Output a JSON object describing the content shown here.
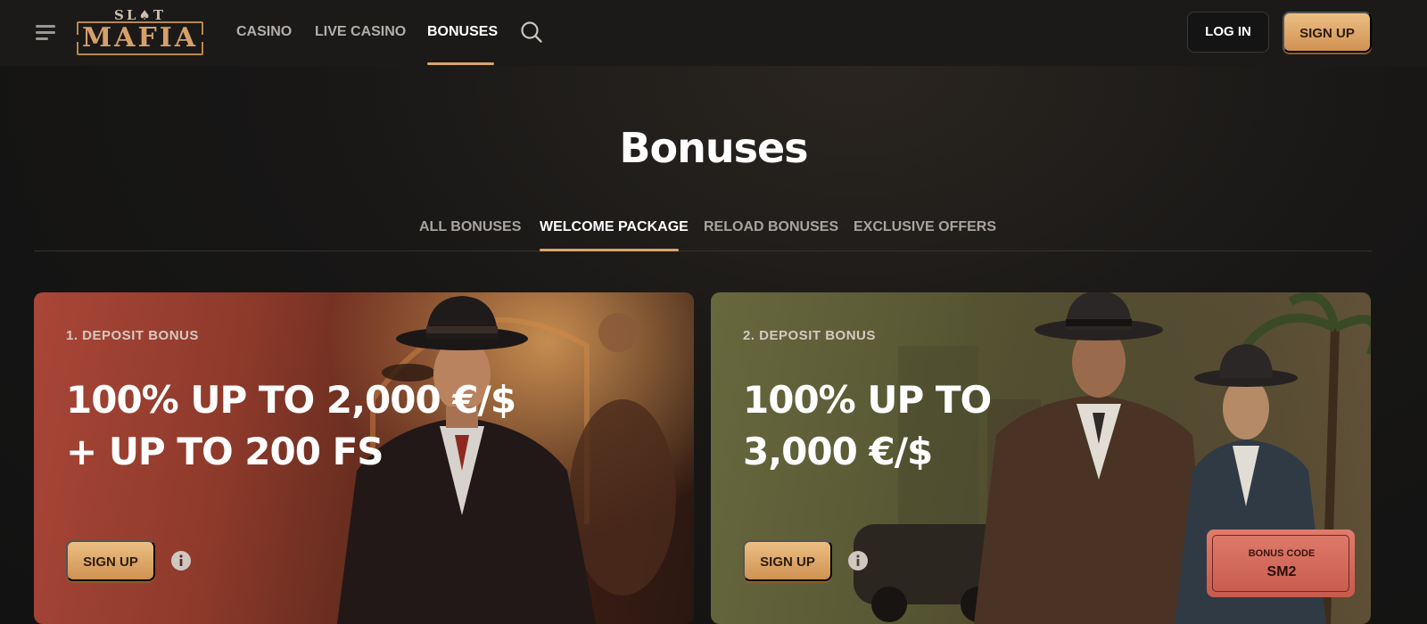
{
  "header": {
    "logo": {
      "top": "SL♠T",
      "main": "MAFIA"
    },
    "nav": [
      {
        "label": "CASINO"
      },
      {
        "label": "LIVE CASINO"
      },
      {
        "label": "BONUSES"
      }
    ],
    "active_nav": "BONUSES",
    "login_label": "LOG IN",
    "signup_label": "SIGN UP"
  },
  "page": {
    "title": "Bonuses",
    "tabs": [
      {
        "label": "ALL BONUSES"
      },
      {
        "label": "WELCOME PACKAGE"
      },
      {
        "label": "RELOAD BONUSES"
      },
      {
        "label": "EXCLUSIVE OFFERS"
      }
    ],
    "active_tab": "WELCOME PACKAGE"
  },
  "cards": [
    {
      "label": "1. DEPOSIT BONUS",
      "headline_line1": "100% UP TO 2,000 €/$",
      "headline_line2": "+ UP TO 200 FS",
      "button_label": "SIGN UP",
      "info_icon": "info-icon"
    },
    {
      "label": "2. DEPOSIT BONUS",
      "headline_line1": "100% UP TO",
      "headline_line2": "3,000 €/$",
      "button_label": "SIGN UP",
      "info_icon": "info-icon",
      "bonus_code_label": "BONUS CODE",
      "bonus_code_value": "SM2"
    }
  ],
  "colors": {
    "accent": "#d9a56c",
    "background": "#141313",
    "header": "#1b1a19",
    "card1": "#a94638",
    "card2": "#67683e",
    "bonus_code": "#e07c6c"
  }
}
